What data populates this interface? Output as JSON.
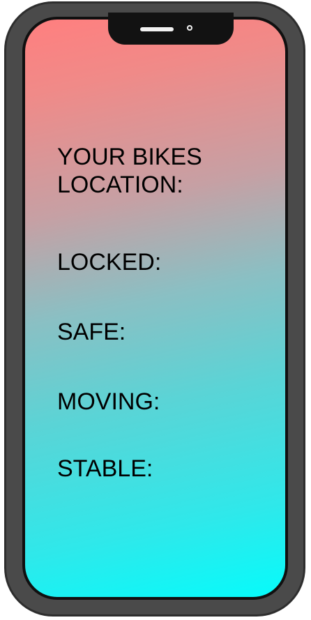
{
  "screen": {
    "labels": {
      "bike_location": "YOUR BIKES\nLOCATION:",
      "locked": "LOCKED:",
      "safe": "SAFE:",
      "moving": "MOVING:",
      "stable": "STABLE:"
    }
  },
  "colors": {
    "gradient_top": "#ff7f7f",
    "gradient_bottom": "#06fbfb",
    "frame": "#4a4a4a",
    "notch": "#121212",
    "text": "#000000"
  }
}
